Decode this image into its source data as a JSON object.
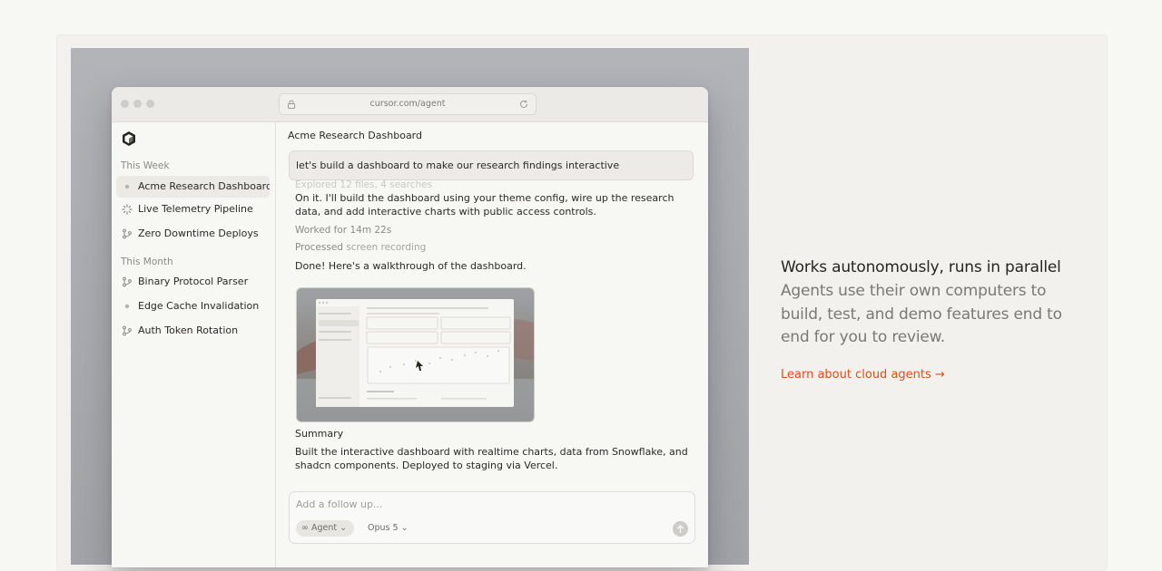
{
  "browser": {
    "url": "cursor.com/agent"
  },
  "sidebar": {
    "section_this_week": "This Week",
    "section_this_month": "This Month",
    "items_this_week": [
      {
        "label": "Acme Research Dashboard",
        "icon": "dot-icon",
        "active": true
      },
      {
        "label": "Live Telemetry Pipeline",
        "icon": "spinner-icon",
        "active": false
      },
      {
        "label": "Zero Downtime Deploys",
        "icon": "branch-icon",
        "active": false
      }
    ],
    "items_this_month": [
      {
        "label": "Binary Protocol Parser",
        "icon": "branch-icon",
        "active": false
      },
      {
        "label": "Edge Cache Invalidation",
        "icon": "dot-icon",
        "active": false
      },
      {
        "label": "Auth Token Rotation",
        "icon": "branch-icon",
        "active": false
      }
    ]
  },
  "chat": {
    "title": "Acme Research Dashboard",
    "user_prompt": "let's build a dashboard to make our research findings interactive",
    "ghost_line": "Explored 12 files, 4 searches",
    "reply_1": "On it. I'll build the dashboard using your theme config, wire up the research data, and add interactive charts with public access controls.",
    "worked_for": "Worked for 14m 22s",
    "processed_prefix": "Processed",
    "processed_item": "screen recording",
    "done_text": "Done! Here's a walkthrough of the dashboard.",
    "summary_heading": "Summary",
    "summary_text": "Built the interactive dashboard with realtime charts, data from Snowflake, and shadcn components. Deployed to staging via Vercel."
  },
  "composer": {
    "placeholder": "Add a follow up...",
    "mode_label": "Agent",
    "model_label": "Opus 5"
  },
  "feature": {
    "headline": "Works autonomously, runs in parallel",
    "description": "Agents use their own computers to build, test, and demo features end to end for you to review.",
    "cta": "Learn about cloud agents →"
  },
  "colors": {
    "accent": "#de4f17",
    "page_bg": "#f7f7f4",
    "stage_bg": "#aeafb4"
  }
}
